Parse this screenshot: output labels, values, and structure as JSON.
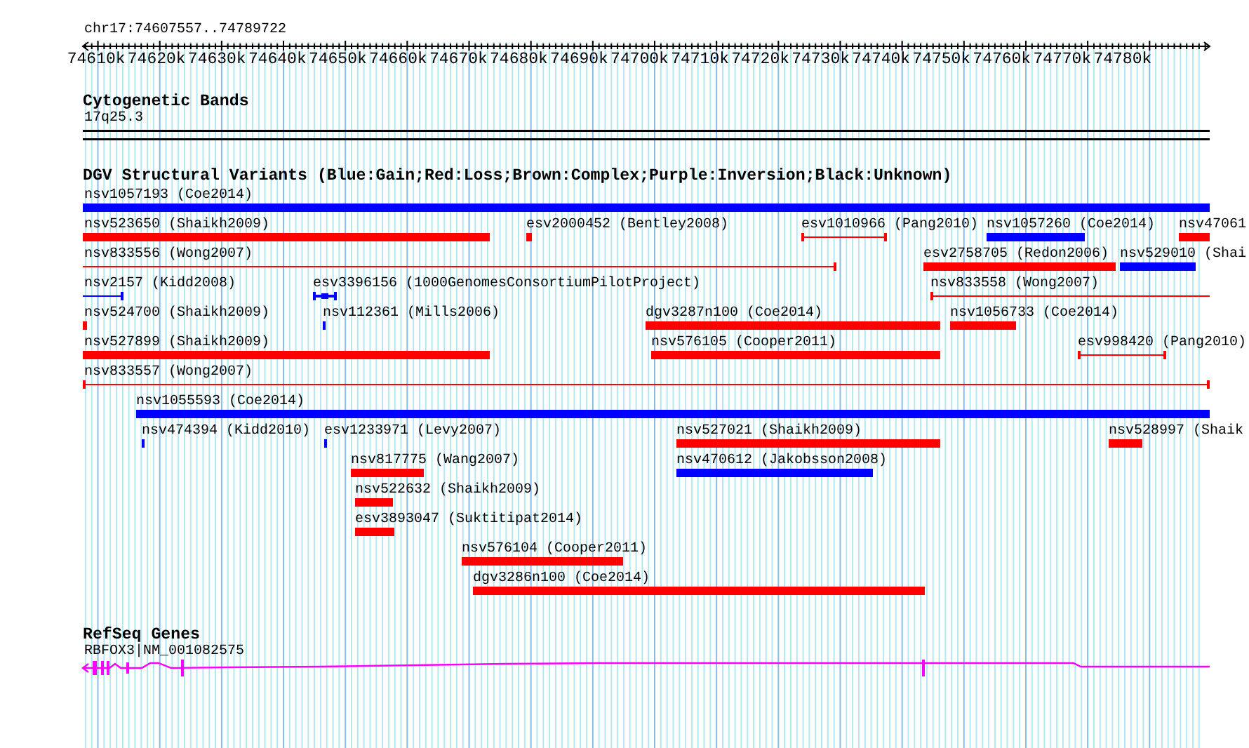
{
  "ruler": {
    "region": "chr17:74607557..74789722",
    "ticks": [
      "74610k",
      "74620k",
      "74630k",
      "74640k",
      "74650k",
      "74660k",
      "74670k",
      "74680k",
      "74690k",
      "74700k",
      "74710k",
      "74720k",
      "74730k",
      "74740k",
      "74750k",
      "74760k",
      "74770k",
      "74780k"
    ]
  },
  "cytogenetic_bands": {
    "title": "Cytogenetic Bands",
    "band": "17q25.3"
  },
  "dgv_variants": {
    "title": "DGV Structural Variants (Blue:Gain;Red:Loss;Brown:Complex;Purple:Inversion;Black:Unknown)",
    "rows": [
      {
        "features": [
          {
            "label": "nsv1057193 (Coe2014)",
            "kind": "bar",
            "color": "#0000ff"
          }
        ]
      },
      {
        "features": [
          {
            "label": "nsv523650 (Shaikh2009)",
            "kind": "bar",
            "color": "#ff0000"
          },
          {
            "label": "esv2000452 (Bentley2008)",
            "kind": "bar",
            "color": "#ff0000"
          },
          {
            "label": "esv1010966 (Pang2010)",
            "kind": "span",
            "color": "#ff0000"
          },
          {
            "label": "nsv1057260 (Coe2014)",
            "kind": "bar",
            "color": "#0000ff"
          },
          {
            "label": "nsv47061",
            "kind": "bar",
            "color": "#ff0000"
          }
        ]
      },
      {
        "features": [
          {
            "label": "nsv833556 (Wong2007)",
            "kind": "span",
            "color": "#ff0000"
          },
          {
            "label": "esv2758705 (Redon2006)",
            "kind": "bar",
            "color": "#ff0000"
          },
          {
            "label": "nsv529010 (Shai",
            "kind": "bar",
            "color": "#0000ff"
          }
        ]
      },
      {
        "features": [
          {
            "label": "nsv2157 (Kidd2008)",
            "kind": "span",
            "color": "#0000ff"
          },
          {
            "label": "esv3396156 (1000GenomesConsortiumPilotProject)",
            "kind": "dumbbell",
            "color": "#0000ff"
          },
          {
            "label": "nsv833558 (Wong2007)",
            "kind": "span",
            "color": "#ff0000"
          }
        ]
      },
      {
        "features": [
          {
            "label": "nsv524700 (Shaikh2009)",
            "kind": "bar",
            "color": "#ff0000"
          },
          {
            "label": "nsv112361 (Mills2006)",
            "kind": "bar",
            "color": "#0000ff"
          },
          {
            "label": "dgv3287n100 (Coe2014)",
            "kind": "bar",
            "color": "#ff0000"
          },
          {
            "label": "nsv1056733 (Coe2014)",
            "kind": "bar",
            "color": "#ff0000"
          }
        ]
      },
      {
        "features": [
          {
            "label": "nsv527899 (Shaikh2009)",
            "kind": "bar",
            "color": "#ff0000"
          },
          {
            "label": "nsv576105 (Cooper2011)",
            "kind": "bar",
            "color": "#ff0000"
          },
          {
            "label": "esv998420 (Pang2010)",
            "kind": "span",
            "color": "#ff0000"
          }
        ]
      },
      {
        "features": [
          {
            "label": "nsv833557 (Wong2007)",
            "kind": "span",
            "color": "#ff0000"
          }
        ]
      },
      {
        "features": [
          {
            "label": "nsv1055593 (Coe2014)",
            "kind": "bar",
            "color": "#0000ff"
          }
        ]
      },
      {
        "features": [
          {
            "label": "nsv474394 (Kidd2010)",
            "kind": "bar",
            "color": "#0000ff"
          },
          {
            "label": "esv1233971 (Levy2007)",
            "kind": "bar",
            "color": "#0000ff"
          },
          {
            "label": "nsv527021 (Shaikh2009)",
            "kind": "bar",
            "color": "#ff0000"
          },
          {
            "label": "nsv528997 (Shaik",
            "kind": "bar",
            "color": "#ff0000"
          }
        ]
      },
      {
        "features": [
          {
            "label": "nsv817775 (Wang2007)",
            "kind": "bar",
            "color": "#ff0000"
          },
          {
            "label": "nsv470612 (Jakobsson2008)",
            "kind": "bar",
            "color": "#0000ff"
          }
        ]
      },
      {
        "features": [
          {
            "label": "nsv522632 (Shaikh2009)",
            "kind": "bar",
            "color": "#ff0000"
          }
        ]
      },
      {
        "features": [
          {
            "label": "esv3893047 (Suktitipat2014)",
            "kind": "bar",
            "color": "#ff0000"
          }
        ]
      },
      {
        "features": [
          {
            "label": "nsv576104 (Cooper2011)",
            "kind": "bar",
            "color": "#ff0000"
          }
        ]
      },
      {
        "features": [
          {
            "label": "dgv3286n100 (Coe2014)",
            "kind": "bar",
            "color": "#ff0000"
          }
        ]
      }
    ]
  },
  "refseq_genes": {
    "title": "RefSeq Genes",
    "gene": "RBFOX3|NM_001082575"
  }
}
